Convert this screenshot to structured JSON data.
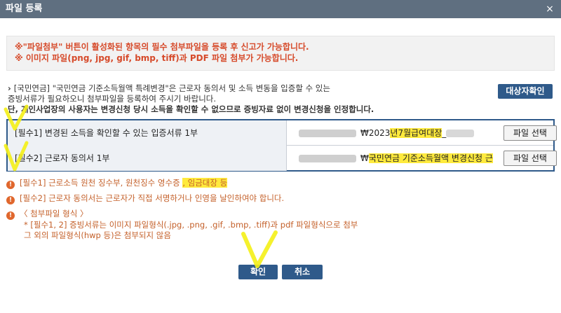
{
  "window": {
    "title": "파일 등록",
    "close_glyph": "×"
  },
  "notice": {
    "lines": [
      "※\"파일첨부\" 버튼이 활성화된 항목의 필수 첨부파일을 등록 후 신고가 가능합니다.",
      "※ 이미지 파일(png, jpg, gif, bmp, tiff)과 PDF 파일 첨부가 가능합니다."
    ]
  },
  "description": {
    "bullet": "›",
    "line1": "[국민연금] \"국민연금 기준소득월액 특례변경\"은 근로자 동의서 및 소득 변동을 입증할 수 있는",
    "line2": "증빙서류가 필요하오니 첨부파일을 등록하여 주시기 바랍니다.",
    "line3": "단, 개인사업장의 사용자는 변경신청 당시 소득을 확인할 수 없으므로 증빙자료 없이 변경신청을 인정합니다."
  },
  "target_button": "대상자확인",
  "required_files": [
    {
      "label": "[필수1] 변경된 소득을 확인할 수 있는 입증서류 1부",
      "path_prefix": "₩2023",
      "path_highlight": "년7월급여대장",
      "path_suffix": "_",
      "button": "파일 선택"
    },
    {
      "label": "[필수2] 근로자 동의서 1부",
      "path_prefix": "₩",
      "path_highlight": "국민연금 기준소득월액 변경신청 근",
      "path_suffix": "",
      "button": "파일 선택"
    }
  ],
  "info": {
    "icon_glyph": "!",
    "item1_text": "[필수1] 근로소득 원천 징수부, 원천징수 영수증 ",
    "item1_highlight": ", 임금대장 등",
    "item2": "[필수2] 근로자 동의서는 근로자가 직접 서명하거나 인영을 날인하여야 합니다.",
    "item3_title": "〈 첨부파일 형식 〉",
    "item3_line1": "* [필수1, 2] 증빙서류는 이미지 파일형식(.jpg, .png, .gif, .bmp, .tiff)과 pdf 파일형식으로 첨부",
    "item3_line2": "그 외의 파일형식(hwp 등)은 첨부되지 않음"
  },
  "footer": {
    "confirm": "확인",
    "cancel": "취소"
  },
  "colors": {
    "titlebar": "#5f6f80",
    "accent": "#2f5a8a",
    "notice_red": "#d64a2a",
    "info_orange": "#c4602a",
    "highlight_yellow": "#ffea3d"
  }
}
